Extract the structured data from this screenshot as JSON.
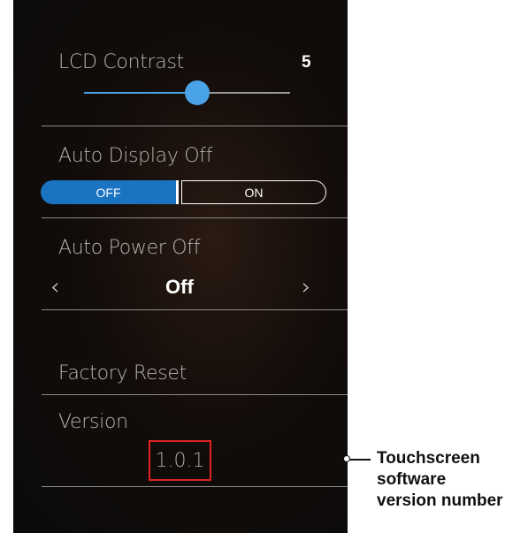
{
  "settings": {
    "lcd_contrast": {
      "label": "LCD Contrast",
      "value": "5",
      "level_fraction": 0.55
    },
    "auto_display_off": {
      "label": "Auto Display Off",
      "off_label": "OFF",
      "on_label": "ON",
      "selected": "OFF"
    },
    "auto_power_off": {
      "label": "Auto Power Off",
      "value": "Off",
      "prev_icon": "chevron-left-icon",
      "next_icon": "chevron-right-icon"
    },
    "factory_reset": {
      "label": "Factory Reset"
    },
    "version": {
      "label": "Version",
      "value": "1.0.1"
    }
  },
  "annotation": {
    "text": "Touchscreen software version number",
    "highlight_color": "#e02424"
  },
  "colors": {
    "accent": "#4aa3e6",
    "toggle_active": "#1a74c2"
  }
}
